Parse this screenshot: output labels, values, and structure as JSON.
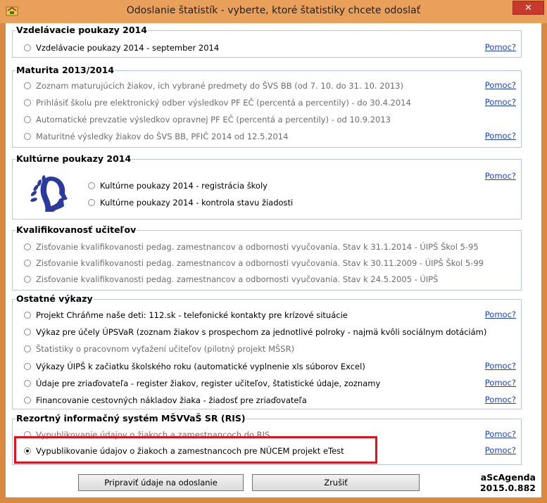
{
  "window": {
    "title": "Odoslanie štatistík - vyberte, ktoré štatistiky chcete odoslať",
    "close_label": "✕"
  },
  "help_label": "Pomoc?",
  "groups": {
    "g1": {
      "title": "Vzdelávacie poukazy 2014",
      "items": [
        "Vzdelávacie poukazy 2014 - september 2014"
      ]
    },
    "g2": {
      "title": "Maturita 2013/2014",
      "items": [
        "Zoznam maturujúcich žiakov, ich vybrané predmety do ŠVS BB (od 7. 10. do 31. 10. 2013)",
        "Prihlásiť školu pre elektronický odber výsledkov PF EČ (percentá a percentily) - do 30.4.2014",
        "Automatické prevzatie výsledkov opravnej PF EČ (percentá a percentily) - od 10.9.2013",
        "Maturitné výsledky žiakov do ŠVS BB, PFIČ 2014 od 12.5.2014"
      ]
    },
    "g3": {
      "title": "Kultúrne poukazy 2014",
      "items": [
        "Kultúrne poukazy 2014 - registrácia školy",
        "Kultúrne poukazy 2014 - kontrola stavu žiadosti"
      ]
    },
    "g4": {
      "title": "Kvalifikovanosť učiteľov",
      "items": [
        "Zisťovanie kvalifikovanosti pedag. zamestnancov a odbornosti vyučovania. Stav k 31.1.2014 - ÚIPŠ Škol 5-95",
        "Zisťovanie kvalifikovanosti pedag. zamestnancov a odbornosti vyučovania. Stav k 30.11.2009 - ÚIPŠ Škol 5-99",
        "Zisťovanie kvalifikovanosti pedag. zamestnancov a odbornosti vyučovania. Stav k 24.5.2005 - ÚIPŠ"
      ]
    },
    "g5": {
      "title": "Ostatné výkazy",
      "items": [
        "Projekt Chráňme naše deti: 112.sk - telefonické kontakty pre krízové situácie",
        "Výkaz pre účely ÚPSVaR (zoznam žiakov s prospechom za jednotlivé polroky - najmä kvôli sociálnym dotáciám)",
        "Štatistiky o pracovnom vyťažení učiteľov (pilotný projekt MŠSR)",
        "Výkazy ÚIPŠ k začiatku školského roku (automatické vyplnenie xls súborov Excel)",
        "Údaje pre zriaďovateľa - register žiakov, register učiteľov, štatistické údaje, zoznamy",
        "Financovanie cestovných nákladov žiaka - žiadosť pre zriaďovateľa"
      ]
    },
    "g6": {
      "title": "Rezortný informačný systém MŠVVaŠ SR (RIS)",
      "items": [
        "Vypublikovanie údajov o žiakoch a zamestnancoch do RIS",
        "Vypublikovanie údajov o žiakoch a zamestnancoch pre NÚCEM projekt eTest"
      ]
    }
  },
  "buttons": {
    "prepare": "Pripraviť údaje na odoslanie",
    "cancel": "Zrušiť"
  },
  "brand": {
    "name": "aScAgenda",
    "version": "2015.0.882"
  }
}
